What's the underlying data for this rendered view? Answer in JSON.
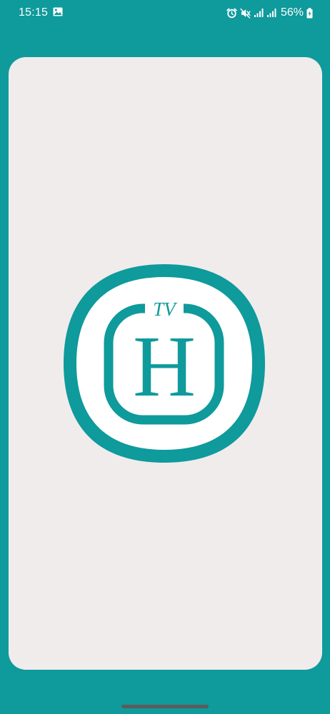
{
  "status_bar": {
    "time": "15:15",
    "battery_percent": "56%",
    "icons": [
      "gallery-icon",
      "alarm-icon",
      "mute-icon",
      "signal-icon",
      "signal-icon",
      "battery-charging-icon"
    ]
  },
  "splash": {
    "logo_badge_text": "TV",
    "logo_letter": "H"
  },
  "colors": {
    "brand_teal": "#0f9a9c",
    "card_background": "#f0ecec",
    "logo_inner": "#ffffff"
  }
}
